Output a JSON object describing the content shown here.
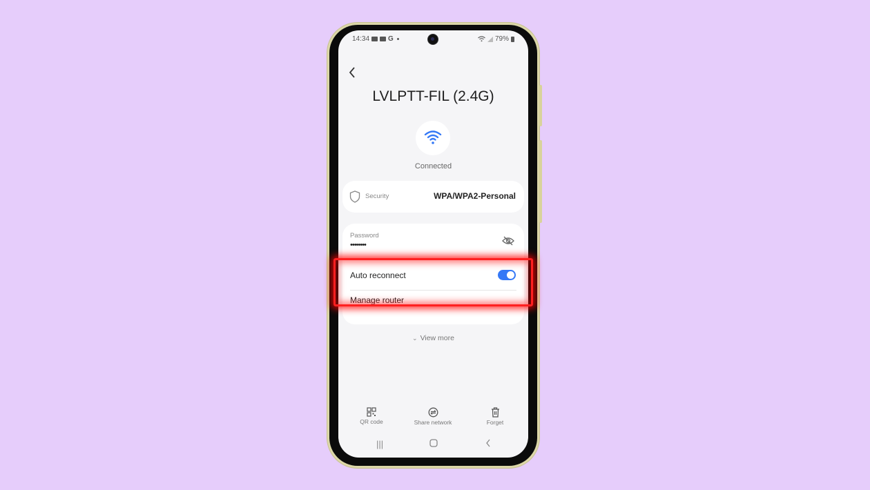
{
  "status_bar": {
    "time": "14:34",
    "battery": "79%"
  },
  "header": {
    "back_icon": "chevron-left-icon",
    "title": "LVLPTT-FIL (2.4G)"
  },
  "connection": {
    "icon": "wifi-icon",
    "status": "Connected",
    "accent_color": "#3478f6"
  },
  "security": {
    "icon": "shield-icon",
    "label": "Security",
    "value": "WPA/WPA2-Personal"
  },
  "password": {
    "label": "Password",
    "value": "••••••••",
    "visibility_icon": "eye-off-icon"
  },
  "auto_reconnect": {
    "label": "Auto reconnect",
    "enabled": true
  },
  "manage_router": {
    "label": "Manage router"
  },
  "view_more": {
    "label": "View more"
  },
  "actions": [
    {
      "label": "QR code",
      "icon": "qr-code-icon"
    },
    {
      "label": "Share network",
      "icon": "share-network-icon"
    },
    {
      "label": "Forget",
      "icon": "trash-icon"
    }
  ],
  "nav_bar": {
    "recents": "|||",
    "home": "○",
    "back": "<"
  },
  "highlight_color": "#ff2020"
}
